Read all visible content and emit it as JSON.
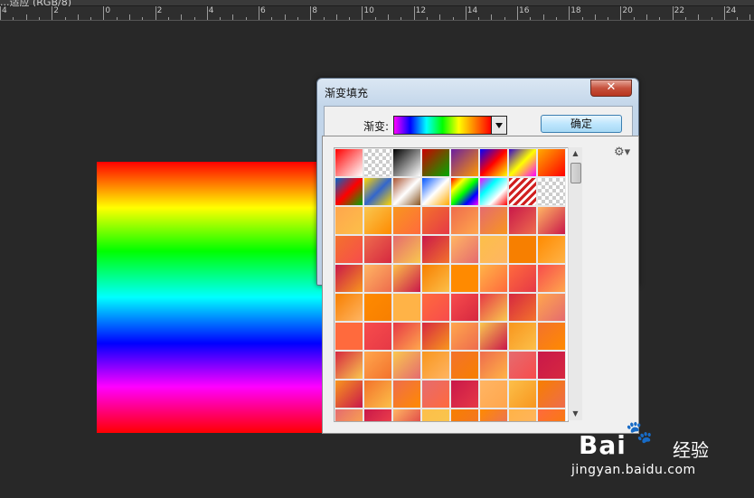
{
  "app": {
    "tab_text": "...适应 (RGB/8)"
  },
  "ruler": {
    "labels": [
      "4",
      "2",
      "0",
      "2",
      "4",
      "6",
      "8",
      "10",
      "12",
      "14",
      "16",
      "18",
      "20",
      "22",
      "24"
    ]
  },
  "dialog": {
    "title": "渐变填充",
    "close_glyph": "✕",
    "gradient_label": "渐变:",
    "ok_label": "确定"
  },
  "picker": {
    "gear_glyph": "⚙▾",
    "scroll_up": "▲",
    "scroll_down": "▼"
  },
  "watermark": {
    "brand": "Bai",
    "paw": "🐾",
    "product": "经验",
    "url": "jingyan.baidu.com"
  },
  "colors": {
    "workspace": "#282828",
    "dialog_title": "#c3d6ea",
    "ok_button": "#bee6fd",
    "close_button": "#c6513c"
  }
}
